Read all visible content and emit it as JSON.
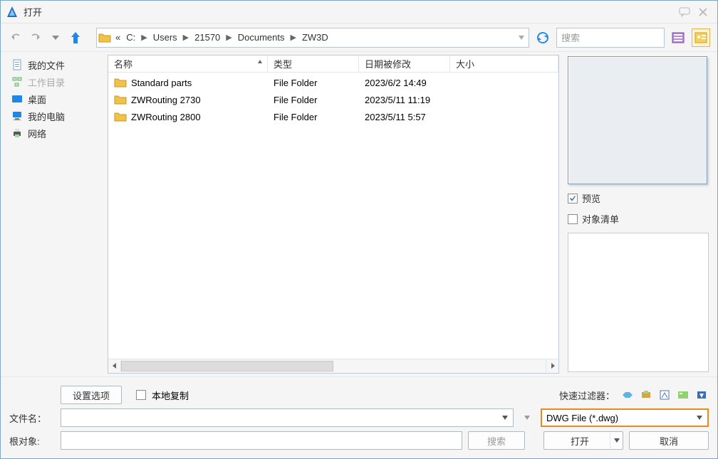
{
  "title": "打开",
  "breadcrumb": {
    "prefix": "«",
    "items": [
      "C:",
      "Users",
      "21570",
      "Documents",
      "ZW3D"
    ]
  },
  "search_placeholder": "搜索",
  "sidebar": {
    "items": [
      {
        "label": "我的文件",
        "disabled": false,
        "icon": "doc"
      },
      {
        "label": "工作目录",
        "disabled": true,
        "icon": "tree"
      },
      {
        "label": "桌面",
        "disabled": false,
        "icon": "desktop"
      },
      {
        "label": "我的电脑",
        "disabled": false,
        "icon": "pc"
      },
      {
        "label": "网络",
        "disabled": false,
        "icon": "printer"
      }
    ]
  },
  "columns": {
    "name": "名称",
    "type": "类型",
    "date": "日期被修改",
    "size": "大小"
  },
  "files": [
    {
      "name": "Standard parts",
      "type": "File Folder",
      "date": "2023/6/2 14:49"
    },
    {
      "name": "ZWRouting 2730",
      "type": "File Folder",
      "date": "2023/5/11 11:19"
    },
    {
      "name": "ZWRouting 2800",
      "type": "File Folder",
      "date": "2023/5/11 5:57"
    }
  ],
  "right": {
    "preview_label": "预览",
    "objectlist_label": "对象清单"
  },
  "bottom": {
    "settings_label": "设置选项",
    "local_copy_label": "本地复制",
    "quick_filter_label": "快速过滤器：",
    "filename_label": "文件名：",
    "root_label": "根对象:",
    "search_btn": "搜索",
    "filetype_value": "DWG File (*.dwg)",
    "open_btn": "打开",
    "cancel_btn": "取消"
  }
}
